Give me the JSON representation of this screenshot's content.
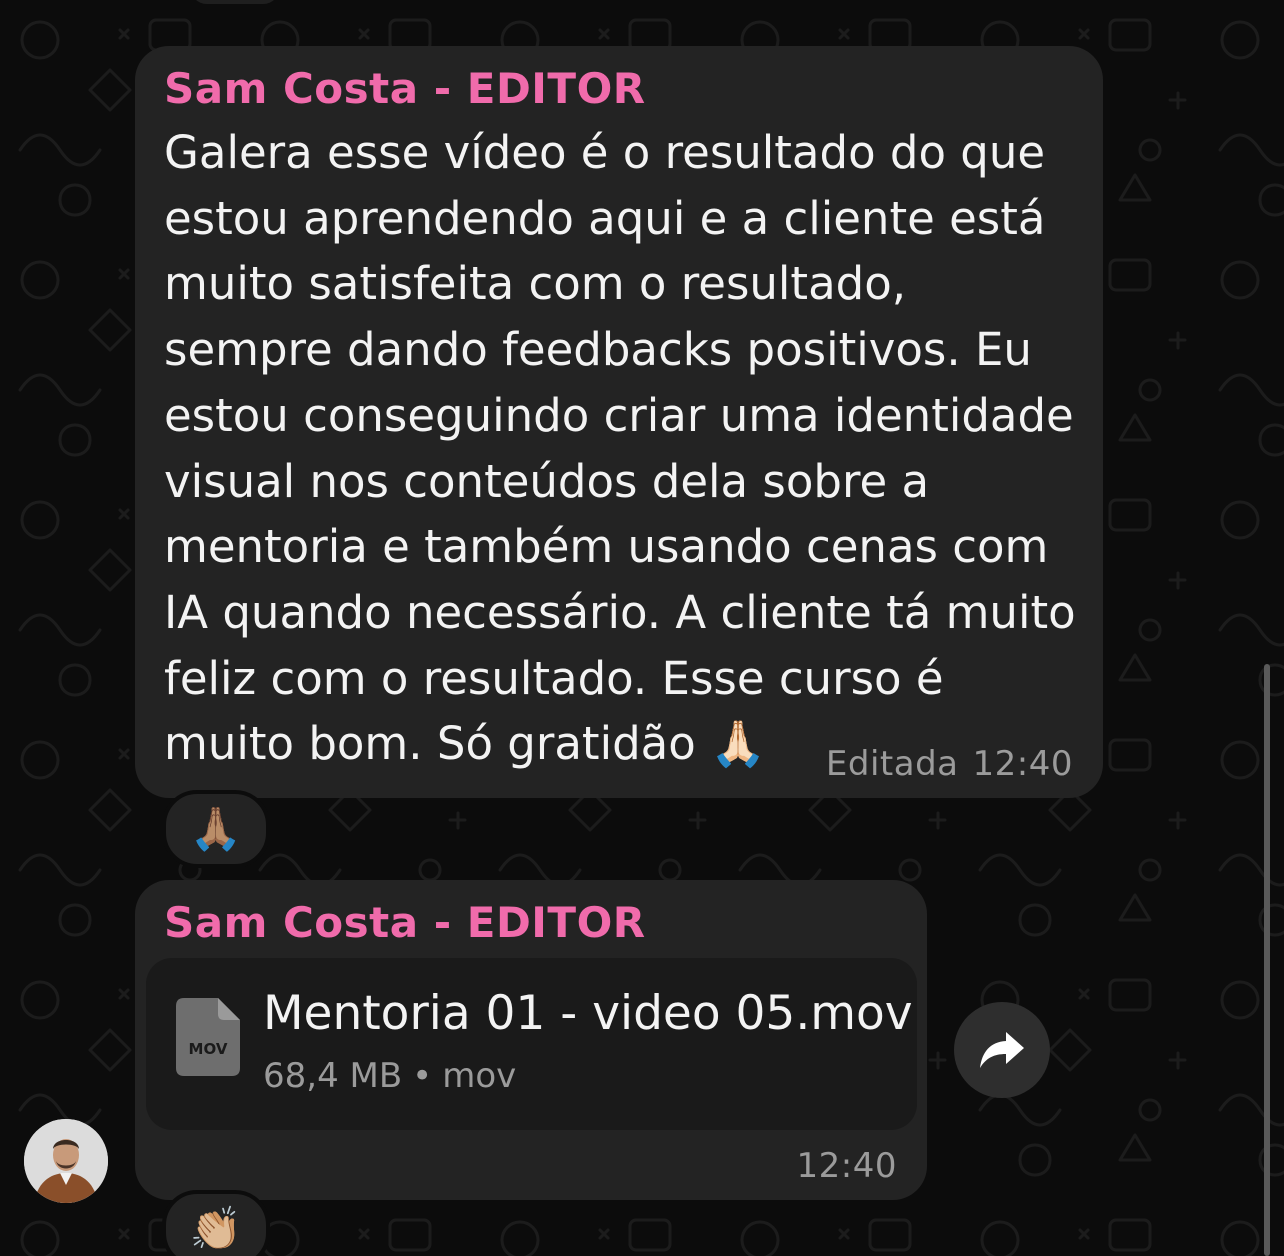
{
  "messages": [
    {
      "sender": "Sam Costa - EDITOR",
      "text": "Galera esse vídeo é o resultado do que\nestou aprendendo aqui e a cliente está\nmuito satisfeita com o resultado,\nsempre dando feedbacks positivos. Eu\nestou conseguindo criar uma identidade\nvisual nos conteúdos dela sobre a\nmentoria e também usando cenas com\nIA quando necessário. A cliente tá muito\nfeliz com o resultado. Esse curso é\nmuito bom. Só gratidão 🙏🏻",
      "edited_label": "Editada",
      "time": "12:40",
      "reaction": "🙏🏽"
    },
    {
      "sender": "Sam Costa - EDITOR",
      "file": {
        "name": "Mentoria 01 - video 05.mov",
        "size": "68,4 MB",
        "separator": "•",
        "ext": "mov",
        "icon_label": "MOV"
      },
      "time": "12:40",
      "reaction": "👏🏼"
    }
  ],
  "colors": {
    "sender": "#f06bab",
    "bubble": "#232323",
    "background": "#0c0c0c"
  },
  "icons": {
    "share": "share-arrow-icon",
    "file": "document-file-icon"
  }
}
